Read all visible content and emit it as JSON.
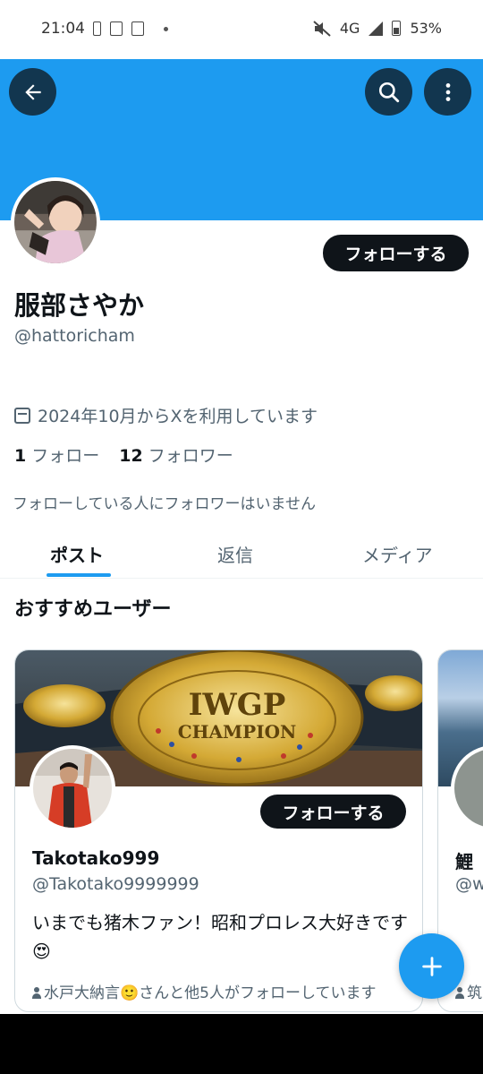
{
  "status_bar": {
    "time": "21:04",
    "network": "4G",
    "battery": "53%"
  },
  "profile": {
    "name": "服部さやか",
    "handle": "@hattoricham",
    "joined": "2024年10月からXを利用しています",
    "following_count": "1",
    "following_label": "フォロー",
    "followers_count": "12",
    "followers_label": "フォロワー",
    "followers_note": "フォローしている人にフォロワーはいません",
    "follow_button": "フォローする"
  },
  "tabs": [
    {
      "label": "ポスト",
      "active": true
    },
    {
      "label": "返信",
      "active": false
    },
    {
      "label": "メディア",
      "active": false
    }
  ],
  "recommended": {
    "title": "おすすめユーザー",
    "cards": [
      {
        "name": "Takotako999",
        "handle": "@Takotako9999999",
        "bio": "いまでも猪木ファン！昭和プロレス大好きです😍",
        "follow_button": "フォローする",
        "followed_by": "水戸大納言🙂さんと他5人がフォローしています",
        "banner_text": "IWGP CHAMPION"
      },
      {
        "name": "鯉",
        "handle": "@w",
        "followed_by": "筑"
      }
    ]
  },
  "icons": {
    "back": "back-arrow-icon",
    "search": "search-icon",
    "more": "more-vertical-icon",
    "compose": "plus-icon",
    "calendar": "calendar-icon"
  },
  "colors": {
    "accent": "#1d9bf0",
    "text": "#0f1419",
    "secondary": "#536471"
  }
}
